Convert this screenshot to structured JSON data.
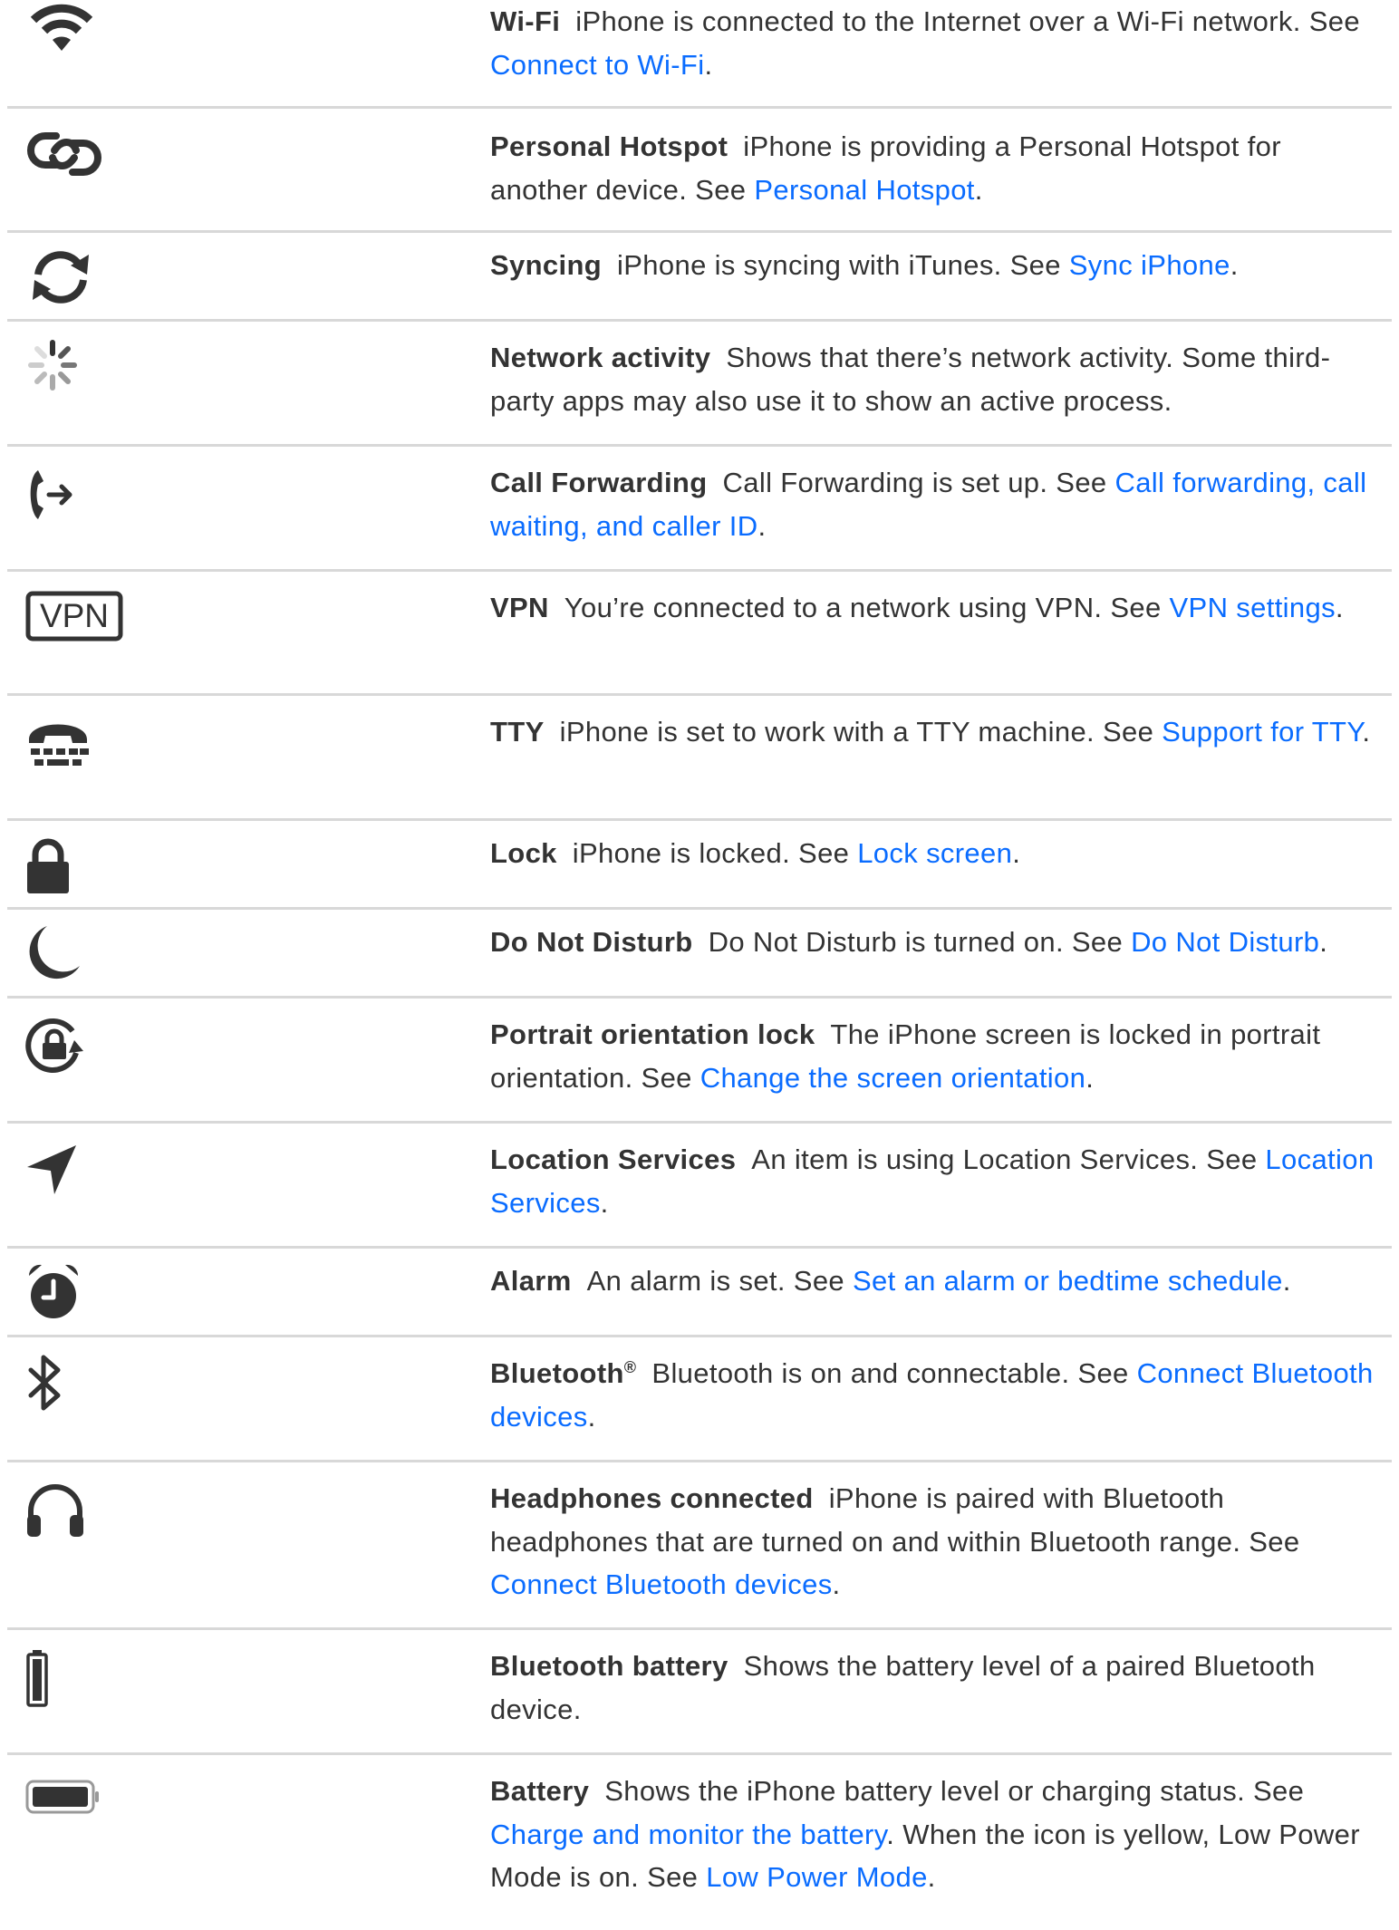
{
  "items": [
    {
      "icon": "wifi-icon",
      "title": "Wi-Fi",
      "desc": "iPhone is connected to the Internet over a Wi-Fi network. See ",
      "link": "Connect to Wi-Fi",
      "after": "."
    },
    {
      "icon": "personal-hotspot-icon",
      "title": "Personal Hotspot",
      "desc": "iPhone is providing a Personal Hotspot for another device. See ",
      "link": "Personal Hotspot",
      "after": "."
    },
    {
      "icon": "syncing-icon",
      "title": "Syncing",
      "desc": "iPhone is syncing with iTunes. See ",
      "link": "Sync iPhone",
      "after": "."
    },
    {
      "icon": "network-activity-icon",
      "title": "Network activity",
      "desc": "Shows that there’s network activity. Some third-party apps may also use it to show an active process.",
      "link": "",
      "after": ""
    },
    {
      "icon": "call-forwarding-icon",
      "title": "Call Forwarding",
      "desc": "Call Forwarding is set up. See ",
      "link": "Call forwarding, call waiting, and caller ID",
      "after": "."
    },
    {
      "icon": "vpn-icon",
      "icon_text": "VPN",
      "title": "VPN",
      "desc": "You’re connected to a network using VPN. See ",
      "link": "VPN settings",
      "after": "."
    },
    {
      "icon": "tty-icon",
      "title": "TTY",
      "desc": "iPhone is set to work with a TTY machine. See ",
      "link": "Support for TTY",
      "after": "."
    },
    {
      "icon": "lock-icon",
      "title": "Lock",
      "desc": "iPhone is locked. See ",
      "link": "Lock screen",
      "after": "."
    },
    {
      "icon": "do-not-disturb-moon-icon",
      "title": "Do Not Disturb",
      "desc": "Do Not Disturb is turned on. See ",
      "link": "Do Not Disturb",
      "after": "."
    },
    {
      "icon": "portrait-orientation-lock-icon",
      "title": "Portrait orientation lock",
      "desc": "The iPhone screen is locked in portrait orientation. See ",
      "link": "Change the screen orientation",
      "after": "."
    },
    {
      "icon": "location-arrow-icon",
      "title": "Location Services",
      "desc": "An item is using Location Services. See ",
      "link": "Location Services",
      "after": "."
    },
    {
      "icon": "alarm-clock-icon",
      "title": "Alarm",
      "desc": "An alarm is set. See ",
      "link": "Set an alarm or bedtime schedule",
      "after": "."
    },
    {
      "icon": "bluetooth-icon",
      "title": "Bluetooth",
      "title_sup": "®",
      "desc": "Bluetooth is on and connectable. See ",
      "link": "Connect Bluetooth devices",
      "after": "."
    },
    {
      "icon": "headphones-icon",
      "title": "Headphones connected",
      "desc": "iPhone is paired with Bluetooth headphones that are turned on and within Bluetooth range. See ",
      "link": "Connect Bluetooth devices",
      "after": "."
    },
    {
      "icon": "bluetooth-battery-icon",
      "title": "Bluetooth battery",
      "desc": "Shows the battery level of a paired Bluetooth device.",
      "link": "",
      "after": ""
    },
    {
      "icon": "battery-icon",
      "title": "Battery",
      "desc": "Shows the iPhone battery level or charging status. See ",
      "link": "Charge and monitor the battery",
      "after": ". When the icon is yellow, Low Power Mode is on. See ",
      "link2": "Low Power Mode",
      "after2": "."
    }
  ],
  "colors": {
    "text": "#333333",
    "link": "#0a6cff",
    "icon": "#333333",
    "divider": "#d8d8d8"
  }
}
